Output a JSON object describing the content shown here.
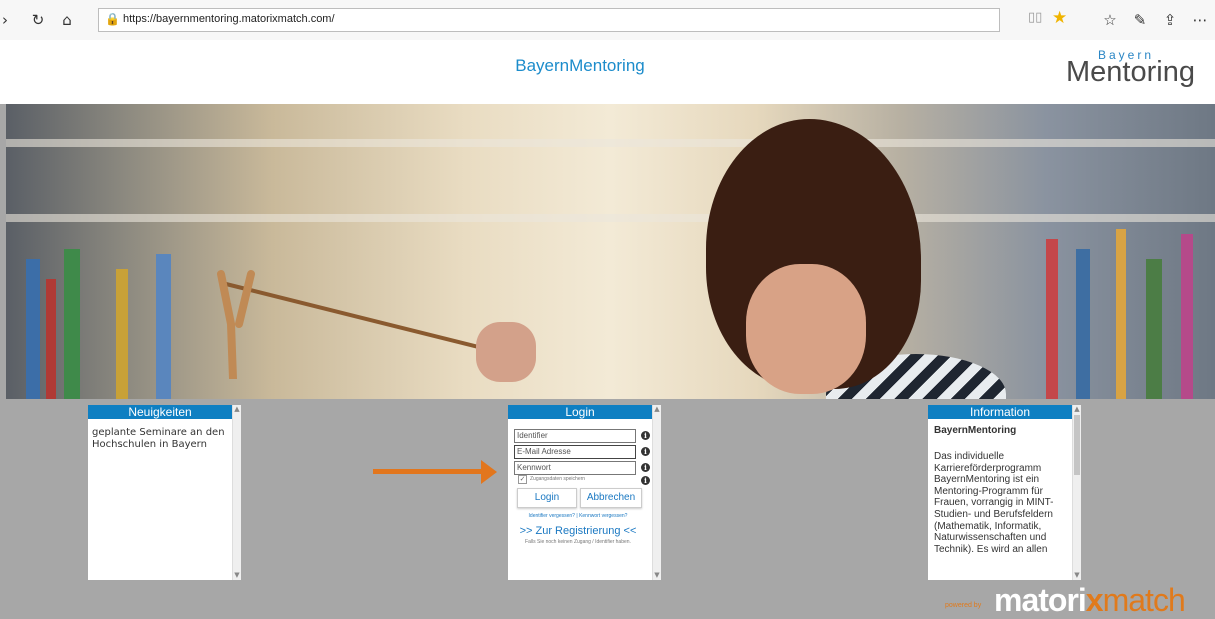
{
  "browser": {
    "url": "https://bayernmentoring.matorixmatch.com/"
  },
  "header": {
    "site_title": "BayernMentoring",
    "logo_small": "Bayern",
    "logo_big": "Mentoring"
  },
  "news": {
    "title": "Neuigkeiten",
    "text": "geplante Seminare an den Hochschulen in Bayern"
  },
  "login": {
    "title": "Login",
    "identifier_placeholder": "Identifier",
    "email_placeholder": "E-Mail Adresse",
    "password_placeholder": "Kennwort",
    "remember_label": "Zugangsdaten speichern",
    "login_button": "Login",
    "cancel_button": "Abbrechen",
    "forgot_identifier": "Identifier vergessen?",
    "forgot_separator": "|",
    "forgot_password": "Kennwort vergessen?",
    "register_link": ">> Zur Registrierung <<",
    "register_note": "Falls Sie noch keinen Zugang / Identifier haben."
  },
  "information": {
    "title": "Information",
    "heading": "BayernMentoring",
    "text": "Das individuelle Karriereförderprogramm BayernMentoring ist ein Mentoring-Programm für Frauen, vorrangig in MINT-Studien- und Berufsfeldern (Mathematik, Informatik, Naturwissenschaften und Technik). Es wird an allen"
  },
  "footer": {
    "powered_by": "powered by",
    "brand_a": "matori",
    "brand_x": "x",
    "brand_b": "match"
  },
  "colors": {
    "accent": "#0f7fc2",
    "arrow": "#e2761d"
  }
}
